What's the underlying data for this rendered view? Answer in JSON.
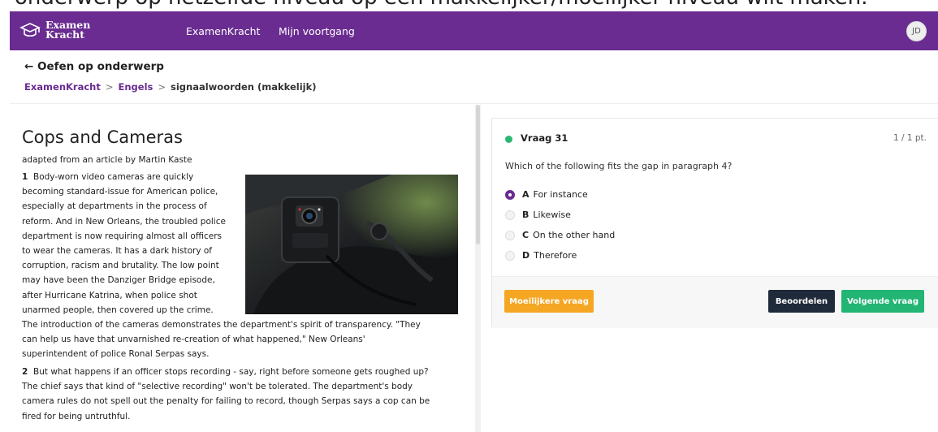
{
  "top_caption": "onderwerp op hetzelfde niveau op een makkelijker/moeilijker niveau wilt maken.",
  "brand": {
    "line1": "Examen",
    "line2": "Kracht"
  },
  "nav": {
    "item1": "ExamenKracht",
    "item2": "Mijn voortgang"
  },
  "user": {
    "initials": "JD"
  },
  "page": {
    "back_label": "← Oefen op onderwerp"
  },
  "breadcrumb": {
    "root": "ExamenKracht",
    "subject": "Engels",
    "current": "signaalwoorden (makkelijk)",
    "sep": ">"
  },
  "article": {
    "title": "Cops and Cameras",
    "byline": "adapted from an article by Martin Kaste",
    "p1_num": "1",
    "p1_lines": [
      "Body-worn video cameras are quickly",
      "becoming standard-issue for American police,",
      "especially at departments in the process of",
      "reform. And in New Orleans, the troubled police",
      "department is now requiring almost all officers",
      "to wear the cameras. It has a dark history of",
      "corruption, racism and brutality. The low point",
      "may have been the Danziger Bridge episode,",
      "after Hurricane Katrina, when police shot",
      "unarmed people, then covered up the crime."
    ],
    "p1_full_lines": [
      "The introduction of the cameras demonstrates the department's spirit of transparency. \"They",
      "can help us have that unvarnished re-creation of what happened,\" New Orleans'",
      "superintendent of police Ronal Serpas says."
    ],
    "p2_num": "2",
    "p2_lines": [
      "But what happens if an officer stops recording - say, right before someone gets roughed up?",
      "The chief says that kind of \"selective recording\" won't be tolerated. The department's body",
      "camera rules do not spell out the penalty for failing to record, though Serpas says a cop can be",
      "fired for being untruthful."
    ]
  },
  "question": {
    "label": "Vraag 31",
    "points": "1 / 1 pt.",
    "text": "Which of the following fits the gap in paragraph 4?",
    "selected": "A",
    "options": [
      {
        "letter": "A",
        "text": "For instance"
      },
      {
        "letter": "B",
        "text": "Likewise"
      },
      {
        "letter": "C",
        "text": "On the other hand"
      },
      {
        "letter": "D",
        "text": "Therefore"
      }
    ]
  },
  "buttons": {
    "harder": "Moeilijkere vraag",
    "grade": "Beoordelen",
    "next": "Volgende vraag"
  },
  "colors": {
    "brand": "#6a2c91",
    "status_green": "#2bb673",
    "harder": "#f5a623",
    "grade": "#1f2a3a",
    "next": "#22b573"
  }
}
